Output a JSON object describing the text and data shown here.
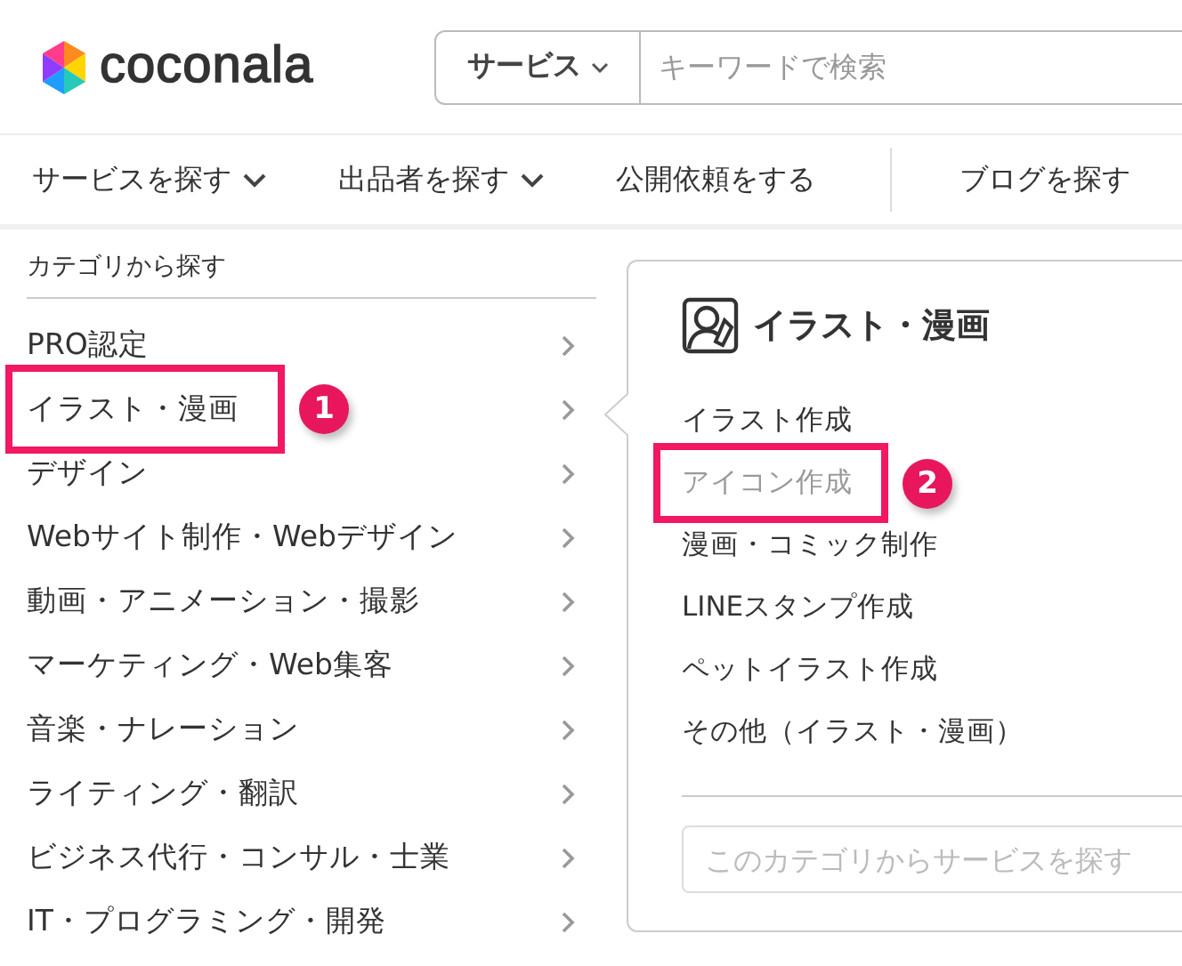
{
  "header": {
    "logo": "coconala",
    "search": {
      "scope": "サービス",
      "placeholder": "キーワードで検索"
    }
  },
  "nav": [
    {
      "label": "サービスを探す",
      "dropdown": true
    },
    {
      "label": "出品者を探す",
      "dropdown": true
    },
    {
      "label": "公開依頼をする",
      "dropdown": false
    },
    {
      "label": "ブログを探す",
      "dropdown": false
    }
  ],
  "categories": {
    "heading": "カテゴリから探す",
    "items": [
      {
        "label": "PRO認定",
        "highlighted": false
      },
      {
        "label": "イラスト・漫画",
        "highlighted": true,
        "callout": "1"
      },
      {
        "label": "デザイン",
        "highlighted": false
      },
      {
        "label": "Webサイト制作・Webデザイン",
        "highlighted": false
      },
      {
        "label": "動画・アニメーション・撮影",
        "highlighted": false
      },
      {
        "label": "マーケティング・Web集客",
        "highlighted": false
      },
      {
        "label": "音楽・ナレーション",
        "highlighted": false
      },
      {
        "label": "ライティング・翻訳",
        "highlighted": false
      },
      {
        "label": "ビジネス代行・コンサル・士業",
        "highlighted": false
      },
      {
        "label": "IT・プログラミング・開発",
        "highlighted": false
      }
    ]
  },
  "subcategory_panel": {
    "title": "イラスト・漫画",
    "items": [
      {
        "label": "イラスト作成",
        "hovered": false,
        "highlighted": false
      },
      {
        "label": "アイコン作成",
        "hovered": true,
        "highlighted": true,
        "callout": "2"
      },
      {
        "label": "漫画・コミック制作",
        "hovered": false,
        "highlighted": false
      },
      {
        "label": "LINEスタンプ作成",
        "hovered": false,
        "highlighted": false
      },
      {
        "label": "ペットイラスト作成",
        "hovered": false,
        "highlighted": false
      },
      {
        "label": "その他（イラスト・漫画）",
        "hovered": false,
        "highlighted": false
      }
    ],
    "search_placeholder": "このカテゴリからサービスを探す"
  }
}
